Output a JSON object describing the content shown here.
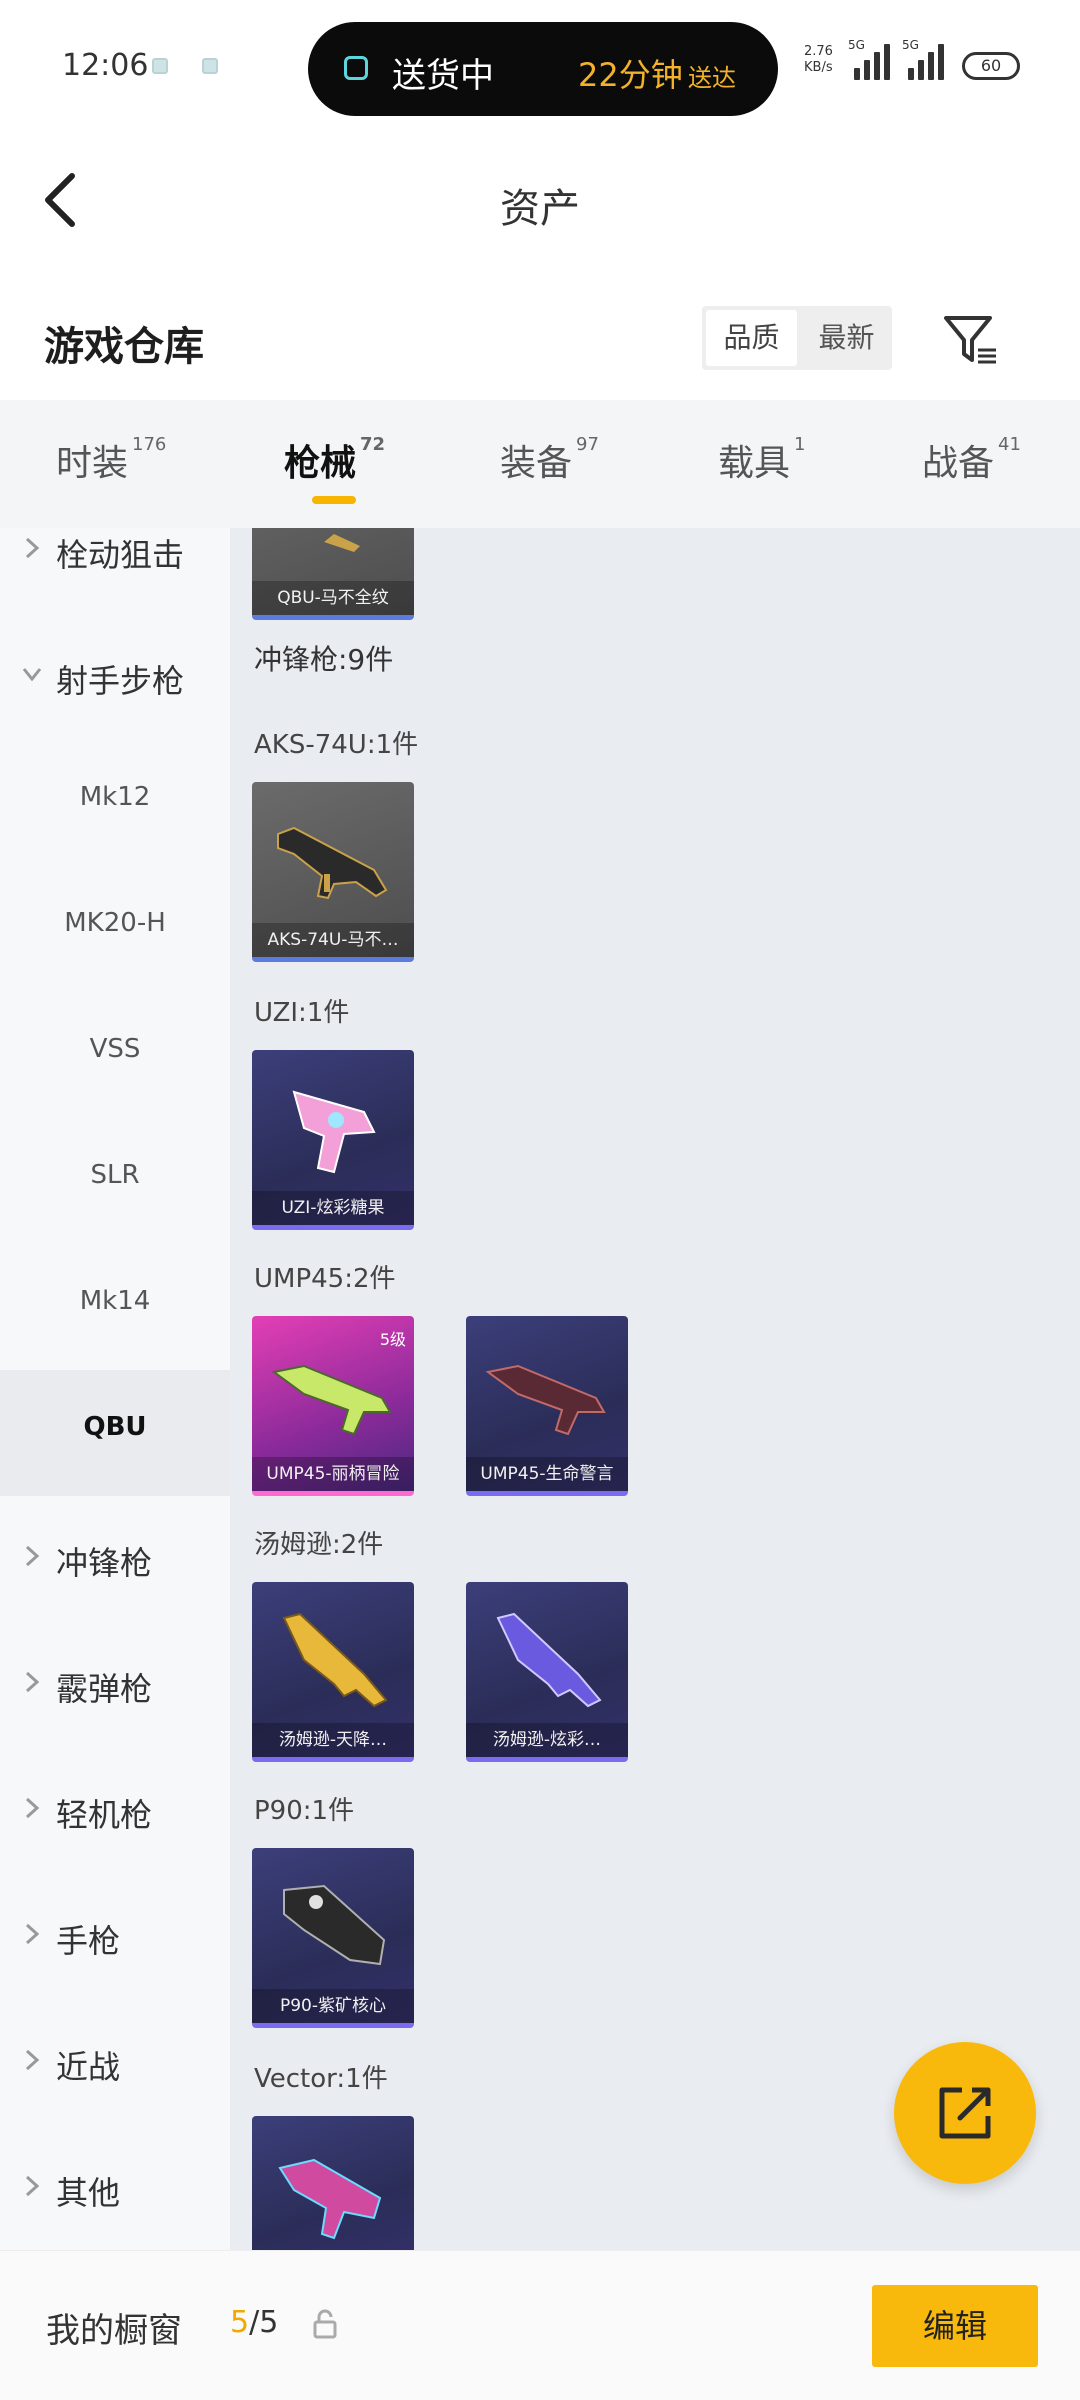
{
  "status_bar": {
    "time": "12:06",
    "delivery_status": "送货中",
    "delivery_eta": "22分钟",
    "delivery_eta_suffix": "送达",
    "net_speed": "2.76",
    "net_unit": "KB/s",
    "signal_1_label": "5G",
    "signal_2_label": "5G",
    "battery": "60"
  },
  "header": {
    "title": "资产"
  },
  "warehouse": {
    "title": "游戏仓库",
    "sort_options": [
      "品质",
      "最新"
    ]
  },
  "tabs": [
    {
      "label": "时装",
      "count": "176"
    },
    {
      "label": "枪械",
      "count": "72"
    },
    {
      "label": "装备",
      "count": "97"
    },
    {
      "label": "载具",
      "count": "1"
    },
    {
      "label": "战备",
      "count": "41"
    }
  ],
  "sidebar": {
    "groups": [
      {
        "label": "栓动狙击"
      },
      {
        "label": "射手步枪"
      }
    ],
    "subitems": [
      "Mk12",
      "MK20-H",
      "VSS",
      "SLR",
      "Mk14",
      "QBU"
    ],
    "groups_after": [
      "冲锋枪",
      "霰弹枪",
      "轻机枪",
      "手枪",
      "近战",
      "其他"
    ]
  },
  "content": {
    "top_card_caption": "QBU-马不全纹",
    "section_title": "冲锋枪:9件",
    "groups": [
      {
        "title": "AKS-74U:1件",
        "cards": [
          {
            "caption": "AKS-74U-马不…"
          }
        ]
      },
      {
        "title": "UZI:1件",
        "cards": [
          {
            "caption": "UZI-炫彩糖果"
          }
        ]
      },
      {
        "title": "UMP45:2件",
        "cards": [
          {
            "caption": "UMP45-丽柄冒险",
            "level": "5级"
          },
          {
            "caption": "UMP45-生命警言"
          }
        ]
      },
      {
        "title": "汤姆逊:2件",
        "cards": [
          {
            "caption": "汤姆逊-天降…"
          },
          {
            "caption": "汤姆逊-炫彩…"
          }
        ]
      },
      {
        "title": "P90:1件",
        "cards": [
          {
            "caption": "P90-紫矿核心"
          }
        ]
      },
      {
        "title": "Vector:1件",
        "cards": []
      }
    ]
  },
  "bottom_bar": {
    "label": "我的橱窗",
    "count_current": "5",
    "count_total": "/5",
    "edit_label": "编辑"
  },
  "colors": {
    "accent": "#f8b80c",
    "tab_underline": "#f7b500"
  }
}
